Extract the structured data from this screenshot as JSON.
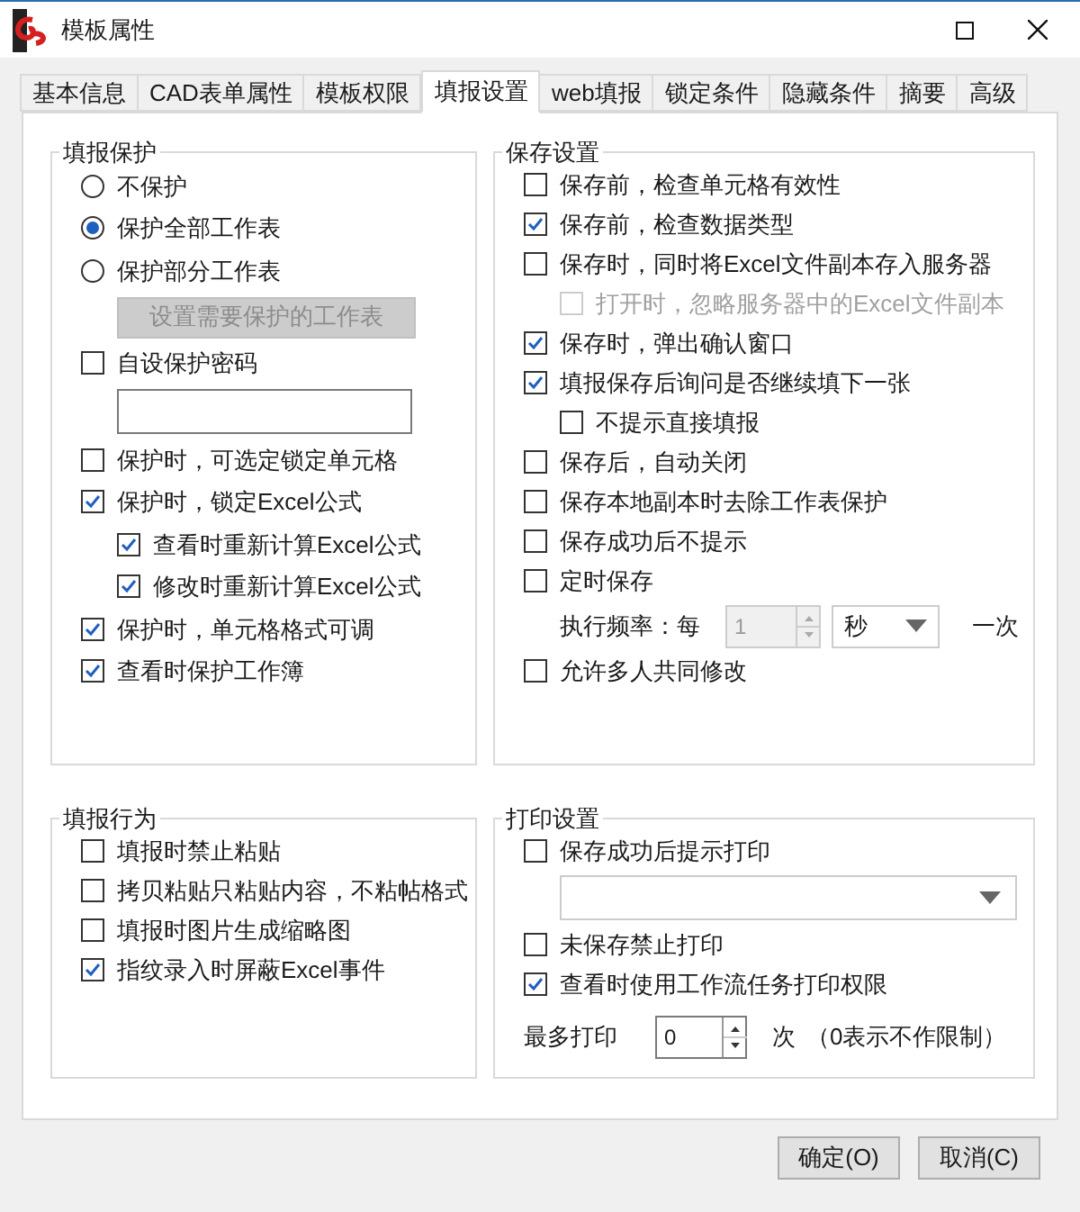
{
  "window": {
    "title": "模板属性"
  },
  "tabs": [
    {
      "label": "基本信息",
      "selected": false
    },
    {
      "label": "CAD表单属性",
      "selected": false
    },
    {
      "label": "模板权限",
      "selected": false
    },
    {
      "label": "填报设置",
      "selected": true
    },
    {
      "label": "web填报",
      "selected": false
    },
    {
      "label": "锁定条件",
      "selected": false
    },
    {
      "label": "隐藏条件",
      "selected": false
    },
    {
      "label": "摘要",
      "selected": false
    },
    {
      "label": "高级",
      "selected": false
    }
  ],
  "groups": [
    {
      "title": "填报保护",
      "items": [
        {
          "kind": "radio",
          "label": "不保护",
          "selected": false
        },
        {
          "kind": "radio",
          "label": "保护全部工作表",
          "selected": true
        },
        {
          "kind": "radio",
          "label": "保护部分工作表",
          "selected": false,
          "children": [
            {
              "kind": "button",
              "label": "设置需要保护的工作表",
              "disabled": true
            }
          ]
        },
        {
          "kind": "checkbox",
          "label": "自设保护密码",
          "checked": false,
          "children": [
            {
              "kind": "text-field"
            }
          ]
        },
        {
          "kind": "checkbox",
          "label": "保护时，可选定锁定单元格",
          "checked": false
        },
        {
          "kind": "checkbox",
          "label": "保护时，锁定Excel公式",
          "checked": true,
          "children": [
            {
              "kind": "checkbox",
              "label": "查看时重新计算Excel公式",
              "checked": true
            },
            {
              "kind": "checkbox",
              "label": "修改时重新计算Excel公式",
              "checked": true
            }
          ]
        },
        {
          "kind": "checkbox",
          "label": "保护时，单元格格式可调",
          "checked": true
        },
        {
          "kind": "checkbox",
          "label": "查看时保护工作簿",
          "checked": true
        }
      ]
    },
    {
      "title": "保存设置",
      "items": [
        {
          "kind": "checkbox",
          "label": "保存前，检查单元格有效性",
          "checked": false
        },
        {
          "kind": "checkbox",
          "label": "保存前，检查数据类型",
          "checked": true
        },
        {
          "kind": "checkbox",
          "label": "保存时，同时将Excel文件副本存入服务器",
          "checked": false,
          "children": [
            {
              "kind": "checkbox",
              "label": "打开时，忽略服务器中的Excel文件副本",
              "checked": false,
              "disabled": true
            }
          ]
        },
        {
          "kind": "checkbox",
          "label": "保存时，弹出确认窗口",
          "checked": true
        },
        {
          "kind": "checkbox",
          "label": "填报保存后询问是否继续填下一张",
          "checked": true,
          "children": [
            {
              "kind": "checkbox",
              "label": "不提示直接填报",
              "checked": false,
              "disabled": false
            }
          ]
        },
        {
          "kind": "checkbox",
          "label": "保存后，自动关闭",
          "checked": false
        },
        {
          "kind": "checkbox",
          "label": "保存本地副本时去除工作表保护",
          "checked": false
        },
        {
          "kind": "checkbox",
          "label": "保存成功后不提示",
          "checked": false
        },
        {
          "kind": "checkbox",
          "label": "定时保存",
          "checked": false,
          "children": [
            {
              "kind": "frequency",
              "label": "执行频率：每",
              "value": "1",
              "unit": "秒",
              "suffix": "一次",
              "disabled": true
            }
          ]
        },
        {
          "kind": "checkbox",
          "label": "允许多人共同修改",
          "checked": false
        }
      ]
    },
    {
      "title": "填报行为",
      "items": [
        {
          "kind": "checkbox",
          "label": "填报时禁止粘贴",
          "checked": false
        },
        {
          "kind": "checkbox",
          "label": "拷贝粘贴只粘贴内容，不粘帖格式",
          "checked": false
        },
        {
          "kind": "checkbox",
          "label": "填报时图片生成缩略图",
          "checked": false
        },
        {
          "kind": "checkbox",
          "label": "指纹录入时屏蔽Excel事件",
          "checked": true
        }
      ]
    },
    {
      "title": "打印设置",
      "items": [
        {
          "kind": "checkbox",
          "label": "保存成功后提示打印",
          "checked": false,
          "children": [
            {
              "kind": "dropdown"
            }
          ]
        },
        {
          "kind": "checkbox",
          "label": "未保存禁止打印",
          "checked": false
        },
        {
          "kind": "checkbox",
          "label": "查看时使用工作流任务打印权限",
          "checked": true
        },
        {
          "kind": "spinner",
          "label": "最多打印",
          "value": "0",
          "suffix": "次",
          "note": "（0表示不作限制）"
        }
      ]
    }
  ],
  "buttons": [
    {
      "label": "确定(O)"
    },
    {
      "label": "取消(C)"
    }
  ]
}
